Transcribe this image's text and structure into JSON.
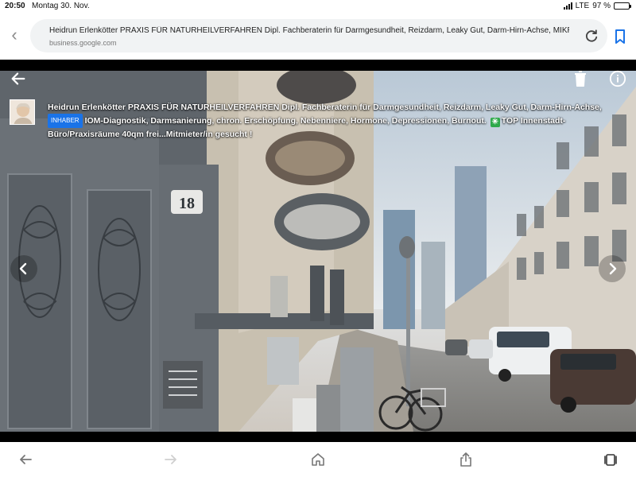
{
  "status_bar": {
    "time": "20:50",
    "date": "Montag 30. Nov.",
    "network": "LTE",
    "battery": "97 %",
    "battery_level": 0.97
  },
  "address_bar": {
    "page_title": "Heidrun Erlenkötter PRAXIS FÜR NATURHEILVERFAHREN Dipl. Fachberaterin für Darmgesundheit, Reizdarm, Leaky Gut, Darm-Hirn-Achse, MIKROBI",
    "domain": "business.google.com"
  },
  "viewer": {
    "caption_part1": "Heidrun Erlenkötter PRAXIS FÜR NATURHEILVERFAHREN Dipl. Fachberaterin für Darmgesundheit, Reizdarm, Leaky Gut, Darm-Hirn-Achse,",
    "owner_badge": "INHABER",
    "caption_part2": "IOM-Diagnostik, Darmsanierung, chron. Erschöpfung, Nebenniere, Hormone, Depressionen, Burnout.",
    "caption_part3": "TOP Innenstadt-Büro/Praxisräume 40qm frei...Mitmieter/in gesucht !",
    "house_number": "18"
  },
  "icons": {
    "viewer_back": "arrow-left-icon",
    "viewer_delete": "trash-icon",
    "viewer_info": "info-icon",
    "prev": "chevron-left-icon",
    "next": "chevron-right-icon",
    "toolbar": [
      "arrow-left-icon",
      "arrow-right-icon",
      "home-icon",
      "share-icon",
      "tabs-icon"
    ]
  },
  "colors": {
    "accent": "#1a73e8",
    "badge_green": "#2ea94a",
    "viewer_background": "#000000"
  }
}
